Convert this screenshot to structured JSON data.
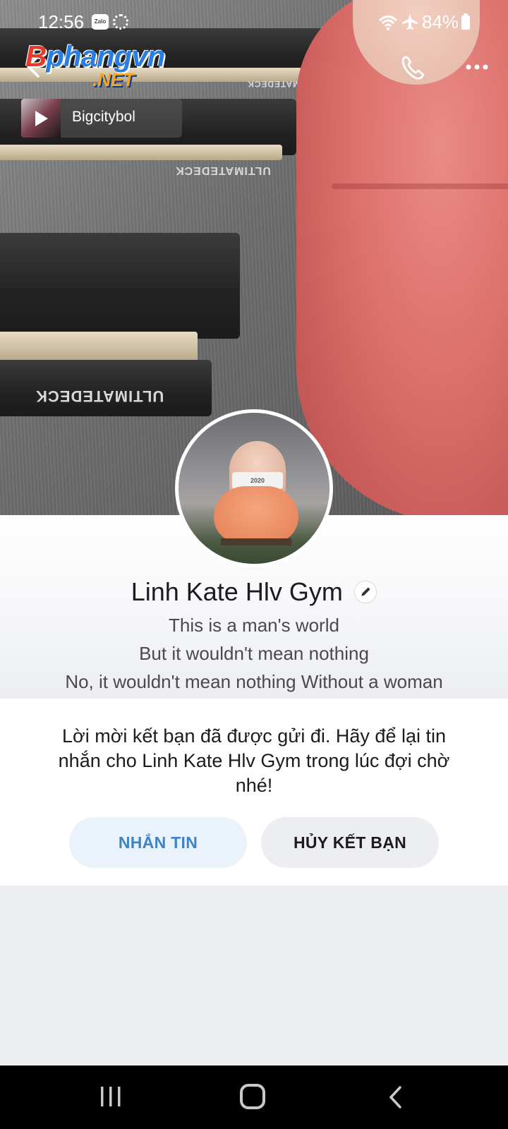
{
  "status_bar": {
    "time": "12:56",
    "zalo_label": "Zalo",
    "battery": "84%",
    "icons": [
      "zalo-icon",
      "sync-icon",
      "wifi-icon",
      "airplane-icon",
      "battery-icon"
    ]
  },
  "watermark": {
    "line1_first": "B",
    "line1_rest": "phangvn",
    "line2": ".NET"
  },
  "header": {
    "icons": [
      "back-arrow-icon",
      "phone-call-icon",
      "more-horizontal-icon"
    ]
  },
  "music": {
    "title": "Bigcitybol"
  },
  "profile": {
    "name": "Linh Kate Hlv Gym",
    "bio": [
      "This is a man's world",
      "But it wouldn't mean nothing",
      "No, it wouldn't mean nothing Without a woman"
    ]
  },
  "friend_request": {
    "message": "Lời mời kết bạn đã được gửi đi. Hãy để lại tin nhắn cho Linh Kate Hlv Gym trong lúc đợi chờ nhé!",
    "message_button": "NHẮN TIN",
    "cancel_button": "HỦY KẾT BẠN"
  },
  "colors": {
    "accent_blue": "#3d85c6",
    "message_button_bg": "#eaf2fb",
    "cancel_button_bg": "#eceef2",
    "page_bg": "#eceef2",
    "outfit_pink": "#dc6f6b"
  },
  "cover_labels": {
    "treadmill_brand": "ULTIMATEDECK"
  },
  "avatar_labels": {
    "shirt_text": "2020"
  },
  "navbar": {
    "icons": [
      "recents-icon",
      "home-icon",
      "nav-back-icon"
    ]
  }
}
